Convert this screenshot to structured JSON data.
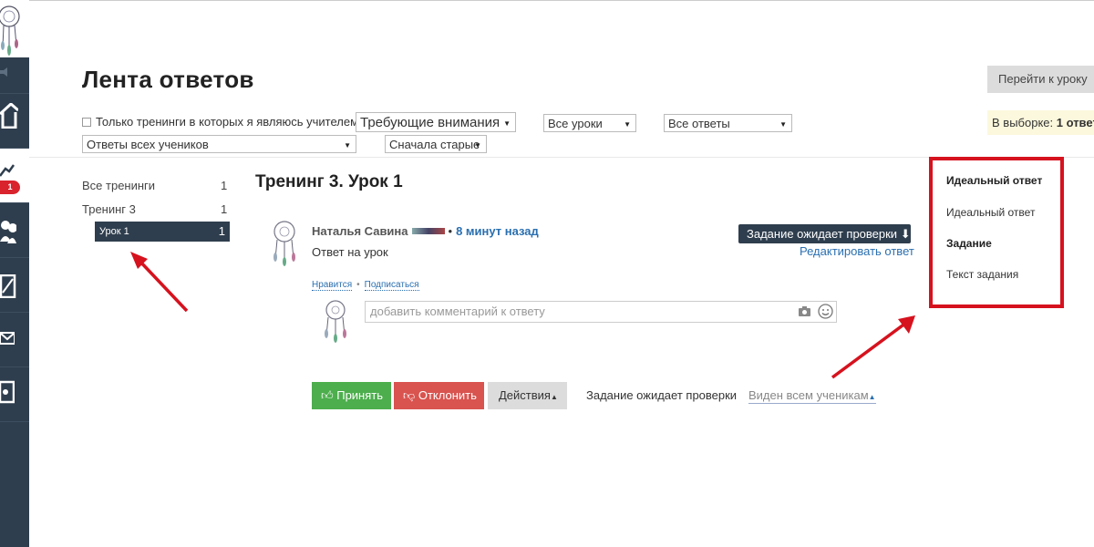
{
  "header": {
    "title": "Лента ответов",
    "goto_lesson": "Перейти к уроку"
  },
  "filters": {
    "only_teacher_label": "Только тренинги в которых я являюсь учителем",
    "attention": "Требующие внимания",
    "lessons": "Все уроки",
    "answers": "Все ответы",
    "students": "Ответы всех учеников",
    "order": "Сначала старые",
    "selection_prefix": "В выборке: ",
    "selection_value": "1 ответ"
  },
  "sidebar": {
    "badge": "1"
  },
  "tree": {
    "items": [
      {
        "label": "Все тренинги",
        "count": "1"
      },
      {
        "label": "Тренинг 3",
        "count": "1"
      },
      {
        "label": "Урок 1",
        "count": "1"
      }
    ]
  },
  "main": {
    "lesson_title": "Тренинг 3. Урок 1",
    "author": "Наталья Савина",
    "time": "8 минут назад",
    "answer_text": "Ответ на урок",
    "status_pill": "Задание ожидает проверки",
    "edit": "Редактировать ответ",
    "like": "Нравится",
    "subscribe": "Подписаться",
    "comment_placeholder": "добавить комментарий к ответу",
    "accept": "Принять",
    "reject": "Отклонить",
    "actions": "Действия",
    "status_text": "Задание ожидает проверки",
    "visibility": "Виден всем ученикам"
  },
  "right_panel": {
    "ideal_heading": "Идеальный ответ",
    "ideal_text": "Идеальный ответ",
    "task_heading": "Задание",
    "task_text": "Текст задания"
  },
  "colors": {
    "sidebar": "#2f3e4e",
    "accept": "#4cae4c",
    "reject": "#d9534f",
    "link": "#2a6fb0",
    "highlight": "#d6121e"
  }
}
